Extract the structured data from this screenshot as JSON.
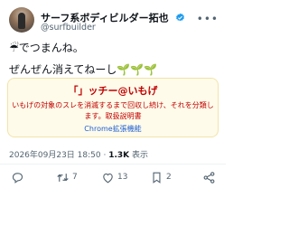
{
  "author": {
    "name": "サーフ系ボディビルダー拓也",
    "handle": "@surfbuilder"
  },
  "tweet": {
    "line1_emoji": "☔",
    "line1_text": "でつまんね。",
    "line2_text": "ぜんぜん消えてねーし",
    "line2_sprouts": "🌱🌱🌱"
  },
  "card": {
    "title": "「」ッチー@いもげ",
    "description": "いもげの対象のスレを消滅するまで回収し続け、それを分類します。取扱説明書",
    "link": "Chrome拡張機能"
  },
  "meta": {
    "datetime": "2026年09月23日 18:50",
    "separator": "·",
    "views": "1.3K",
    "views_label": "表示"
  },
  "actions": {
    "reply_count": "",
    "retweet_count": "7",
    "like_count": "13",
    "bookmark_count": "2"
  },
  "colors": {
    "card_bg": "#fffbea",
    "card_text": "#c00000",
    "link": "#1d5fd3",
    "verified": "#1d9bf0"
  }
}
